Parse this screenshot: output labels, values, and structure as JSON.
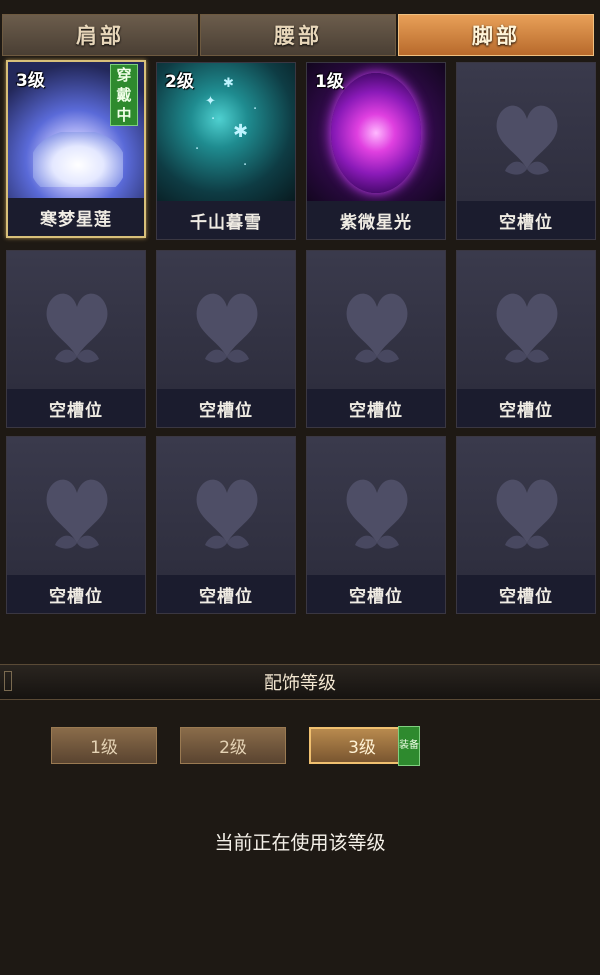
{
  "tabs": [
    {
      "label": "肩部",
      "active": false
    },
    {
      "label": "腰部",
      "active": false
    },
    {
      "label": "脚部",
      "active": true
    }
  ],
  "slots": [
    {
      "name": "寒梦星莲",
      "level": "3级",
      "badge": "穿戴中",
      "art": "lotus-icon",
      "selected": true
    },
    {
      "name": "千山暮雪",
      "level": "2级",
      "badge": "",
      "art": "snow-sparkle-icon",
      "selected": false
    },
    {
      "name": "紫微星光",
      "level": "1级",
      "badge": "",
      "art": "purple-orb-icon",
      "selected": false
    },
    {
      "name": "空槽位",
      "level": "",
      "badge": "",
      "art": "butterfly-icon",
      "selected": false
    },
    {
      "name": "空槽位",
      "level": "",
      "badge": "",
      "art": "butterfly-icon",
      "selected": false
    },
    {
      "name": "空槽位",
      "level": "",
      "badge": "",
      "art": "butterfly-icon",
      "selected": false
    },
    {
      "name": "空槽位",
      "level": "",
      "badge": "",
      "art": "butterfly-icon",
      "selected": false
    },
    {
      "name": "空槽位",
      "level": "",
      "badge": "",
      "art": "butterfly-icon",
      "selected": false
    },
    {
      "name": "空槽位",
      "level": "",
      "badge": "",
      "art": "butterfly-icon",
      "selected": false
    },
    {
      "name": "空槽位",
      "level": "",
      "badge": "",
      "art": "butterfly-icon",
      "selected": false
    },
    {
      "name": "空槽位",
      "level": "",
      "badge": "",
      "art": "butterfly-icon",
      "selected": false
    },
    {
      "name": "空槽位",
      "level": "",
      "badge": "",
      "art": "butterfly-icon",
      "selected": false
    }
  ],
  "section": {
    "title": "配饰等级"
  },
  "levels": [
    {
      "label": "1级",
      "active": false
    },
    {
      "label": "2级",
      "active": false
    },
    {
      "label": "3级",
      "active": true
    }
  ],
  "equip_badge": "装备",
  "status_text": "当前正在使用该等级",
  "colors": {
    "active_tab": "#d88a44",
    "wearing_badge": "#2e8a2e",
    "background": "#1e1914"
  }
}
